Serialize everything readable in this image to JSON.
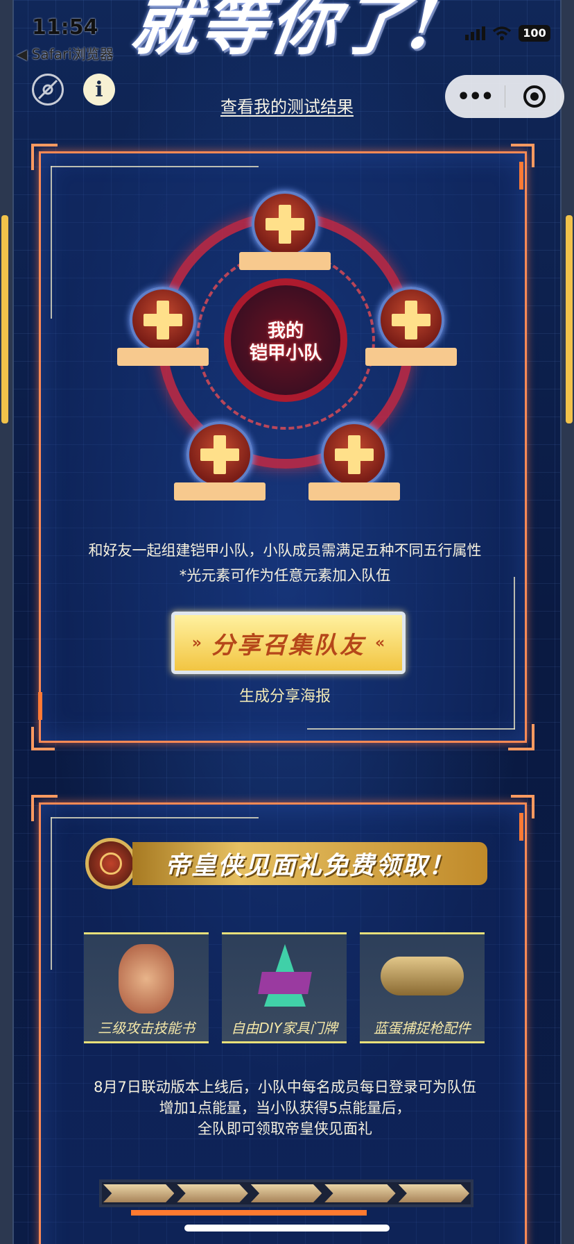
{
  "status_bar": {
    "time": "11:54",
    "back_app": "◀ Safari浏览器",
    "battery": "100"
  },
  "banner": {
    "text": "就等你了!"
  },
  "top": {
    "result_link": "查看我的测试结果",
    "more_glyph": "•••"
  },
  "team": {
    "title_line1": "我的",
    "title_line2": "铠甲小队",
    "slots": [
      "",
      "",
      "",
      "",
      ""
    ],
    "desc_line1": "和好友一起组建铠甲小队，小队成员需满足五种不同五行属性",
    "desc_line2": "*光元素可作为任意元素加入队伍",
    "share_button": "分享召集队友",
    "share_arrows_left": "»",
    "share_arrows_right": "«",
    "poster_link": "生成分享海报"
  },
  "gift": {
    "header": "帝皇侠见面礼免费领取！",
    "items": [
      {
        "name": "三级攻击技能书",
        "icon": "skill-book-icon"
      },
      {
        "name": "自由DIY家具门牌",
        "icon": "door-sign-icon"
      },
      {
        "name": "蓝蛋捕捉枪配件",
        "icon": "gun-part-icon"
      }
    ],
    "desc_line1": "8月7日联动版本上线后，小队中每名成员每日登录可为队伍",
    "desc_line2": "增加1点能量，当小队获得5点能量后，",
    "desc_line3": "全队即可领取帝皇侠见面礼",
    "energy_segments": 5,
    "energy_filled": 0
  },
  "colors": {
    "background": "#0a1838",
    "panel_border": "#ff8a55",
    "accent_gold": "#f2c542",
    "slot_name": "#f7c98e"
  }
}
